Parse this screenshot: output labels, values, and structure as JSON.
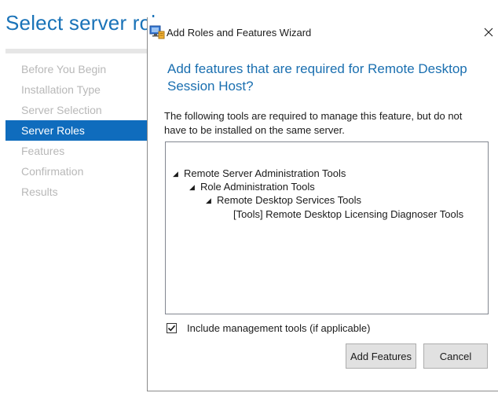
{
  "background_wizard": {
    "title": "Select server roles",
    "nav_items": [
      {
        "label": "Before You Begin",
        "active": false
      },
      {
        "label": "Installation Type",
        "active": false
      },
      {
        "label": "Server Selection",
        "active": false
      },
      {
        "label": "Server Roles",
        "active": true
      },
      {
        "label": "Features",
        "active": false
      },
      {
        "label": "Confirmation",
        "active": false
      },
      {
        "label": "Results",
        "active": false
      }
    ]
  },
  "dialog": {
    "title": "Add Roles and Features Wizard",
    "heading": "Add features that are required for Remote Desktop Session Host?",
    "description": "The following tools are required to manage this feature, but do not have to be installed on the same server.",
    "tree": [
      {
        "label": "Remote Server Administration Tools",
        "level": 0,
        "expanded": true
      },
      {
        "label": "Role Administration Tools",
        "level": 1,
        "expanded": true
      },
      {
        "label": "Remote Desktop Services Tools",
        "level": 2,
        "expanded": true
      },
      {
        "label": "[Tools] Remote Desktop Licensing Diagnoser Tools",
        "level": 3,
        "expanded": false
      }
    ],
    "include_tools": {
      "label": "Include management tools (if applicable)",
      "checked": true
    },
    "add_button": "Add Features",
    "cancel_button": "Cancel"
  },
  "colors": {
    "accent": "#0f6cbd",
    "heading": "#1a6fb0",
    "muted_nav": "#b8b8b8"
  }
}
